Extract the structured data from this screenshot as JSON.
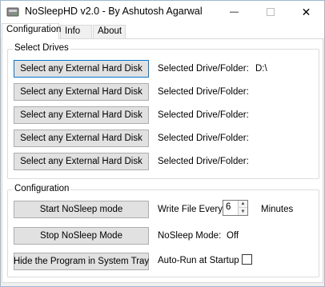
{
  "window": {
    "title": "NoSleepHD v2.0 - By Ashutosh Agarwal",
    "controls": {
      "minimize": "—",
      "close": "✕"
    }
  },
  "tabs": [
    {
      "label": "Configuration",
      "active": true
    },
    {
      "label": "Info",
      "active": false
    },
    {
      "label": "About",
      "active": false
    }
  ],
  "select_drives": {
    "legend": "Select Drives",
    "rows": [
      {
        "button": "Select any External Hard Disk",
        "label": "Selected Drive/Folder:",
        "value": "D:\\"
      },
      {
        "button": "Select any External Hard Disk",
        "label": "Selected Drive/Folder:",
        "value": ""
      },
      {
        "button": "Select any External Hard Disk",
        "label": "Selected Drive/Folder:",
        "value": ""
      },
      {
        "button": "Select any External Hard Disk",
        "label": "Selected Drive/Folder:",
        "value": ""
      },
      {
        "button": "Select any External Hard Disk",
        "label": "Selected Drive/Folder:",
        "value": ""
      }
    ]
  },
  "configuration": {
    "legend": "Configuration",
    "start_button": "Start NoSleep mode",
    "stop_button": "Stop NoSleep Mode",
    "hide_button": "Hide the Program in System Tray",
    "write_label": "Write File Every:",
    "write_value": "6",
    "write_unit": "Minutes",
    "status_label": "NoSleep Mode:",
    "status_value": "Off",
    "autorun_label": "Auto-Run at Startup",
    "autorun_checked": false
  }
}
